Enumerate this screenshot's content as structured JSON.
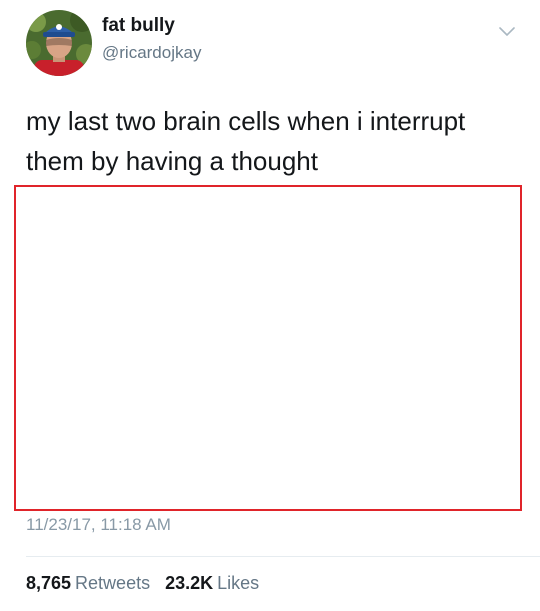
{
  "author": {
    "display_name": "fat bully",
    "handle": "@ricardojkay",
    "avatar_icon": "profile-photo",
    "menu_icon": "chevron-down-icon"
  },
  "tweet": {
    "text": "my last two brain cells when i interrupt them by having a thought",
    "timestamp": "11/23/17, 11:18 AM"
  },
  "stats": {
    "retweets_count": "8,765",
    "retweets_label": "Retweets",
    "likes_count": "23.2K",
    "likes_label": "Likes"
  },
  "colors": {
    "text": "#14171a",
    "secondary": "#657786",
    "timestamp": "#8899a6",
    "media_border": "#e0242a",
    "divider": "#e6ecf0"
  }
}
